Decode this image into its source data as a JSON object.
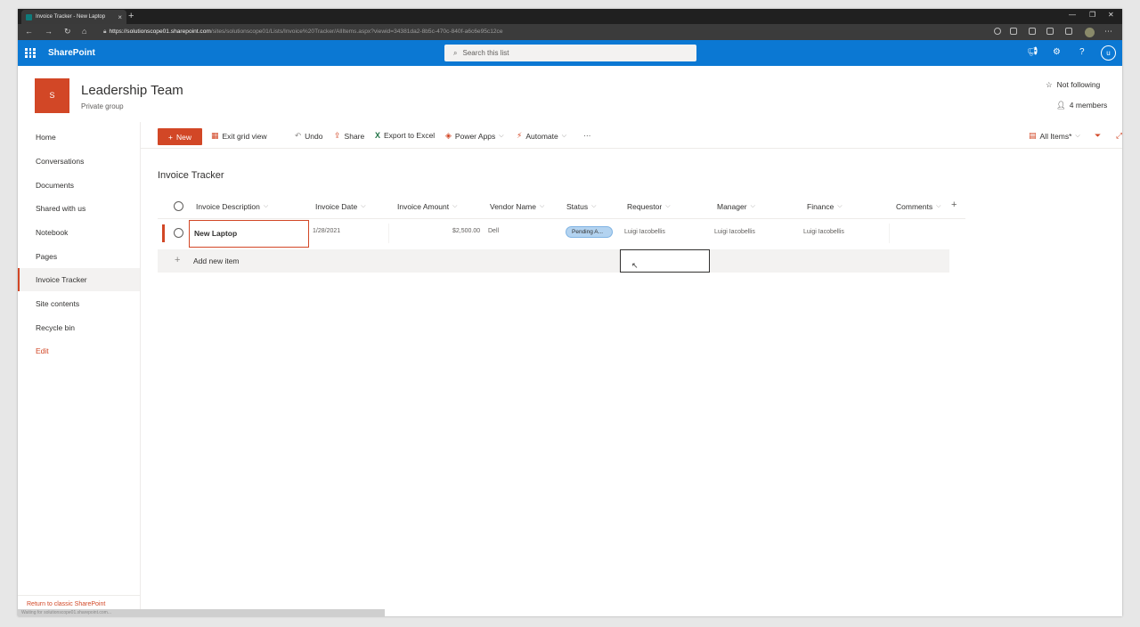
{
  "browser": {
    "tab_title": "Invoice Tracker - New Laptop",
    "url_host": "https://solutionscope01.sharepoint.com",
    "url_path": "/sites/solutionscope01/Lists/Invoice%20Tracker/AllItems.aspx?viewid=34381da2-8b5c-470c-840f-a6c6e95c12ce"
  },
  "suite": {
    "brand": "SharePoint",
    "search_placeholder": "Search this list",
    "user_initial": "u"
  },
  "site": {
    "logo_letter": "S",
    "title": "Leadership Team",
    "subtitle": "Private group",
    "follow_label": "Not following",
    "members_label": "4 members"
  },
  "nav": {
    "items": [
      "Home",
      "Conversations",
      "Documents",
      "Shared with us",
      "Notebook",
      "Pages",
      "Invoice Tracker",
      "Site contents",
      "Recycle bin"
    ],
    "edit": "Edit",
    "classic": "Return to classic SharePoint",
    "status_text": "Waiting for solutionscope01.sharepoint.com..."
  },
  "commands": {
    "new": "New",
    "exit_grid": "Exit grid view",
    "undo": "Undo",
    "share": "Share",
    "export": "Export to Excel",
    "power_apps": "Power Apps",
    "automate": "Automate",
    "more": "···",
    "view": "All Items*"
  },
  "list": {
    "title": "Invoice Tracker",
    "columns": [
      "Invoice Description",
      "Invoice Date",
      "Invoice Amount",
      "Vendor Name",
      "Status",
      "Requestor",
      "Manager",
      "Finance",
      "Comments"
    ],
    "row": {
      "description": "New Laptop",
      "date": "1/28/2021",
      "amount": "$2,500.00",
      "vendor": "Dell",
      "status": "Pending A...",
      "requestor": "Luigi Iacobellis",
      "manager": "Luigi Iacobellis",
      "finance": "Luigi Iacobellis"
    },
    "add_new": "Add new item"
  },
  "colors": {
    "suite_blue": "#0b78d3",
    "accent_orange": "#d24726"
  }
}
